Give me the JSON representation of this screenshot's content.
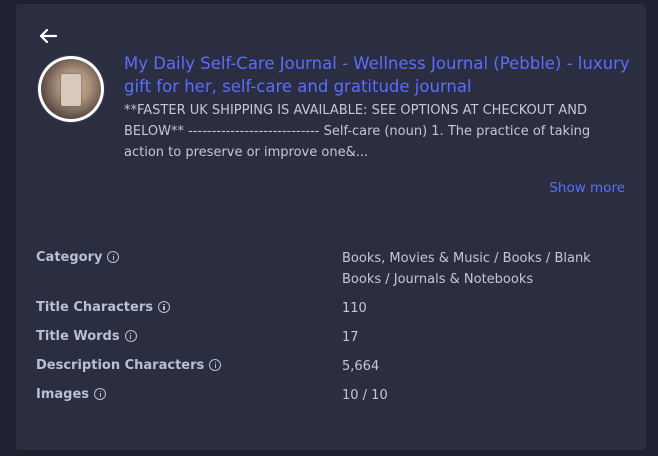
{
  "header": {
    "back_icon": "arrow-left-icon"
  },
  "product": {
    "avatar_icon": "product-thumbnail",
    "title": "My Daily Self-Care Journal - Wellness Journal (Pebble) - luxury gift for her, self-care and gratitude journal",
    "description": "**FASTER UK SHIPPING IS AVAILABLE: SEE OPTIONS AT CHECKOUT AND BELOW** ---------------------------- Self-care (noun) 1. The practice of taking action to preserve or improve one&...",
    "show_more": "Show more"
  },
  "details": [
    {
      "label": "Category",
      "value": "Books, Movies & Music / Books / Blank Books / Journals & Notebooks"
    },
    {
      "label": "Title Characters",
      "value": "110"
    },
    {
      "label": "Title Words",
      "value": "17"
    },
    {
      "label": "Description Characters",
      "value": "5,664"
    },
    {
      "label": "Images",
      "value": "10 / 10"
    }
  ],
  "colors": {
    "background": "#1e2130",
    "card": "#2a2e40",
    "accent": "#5b6dff",
    "text": "#c3c7d8",
    "label": "#b8bfd6"
  }
}
